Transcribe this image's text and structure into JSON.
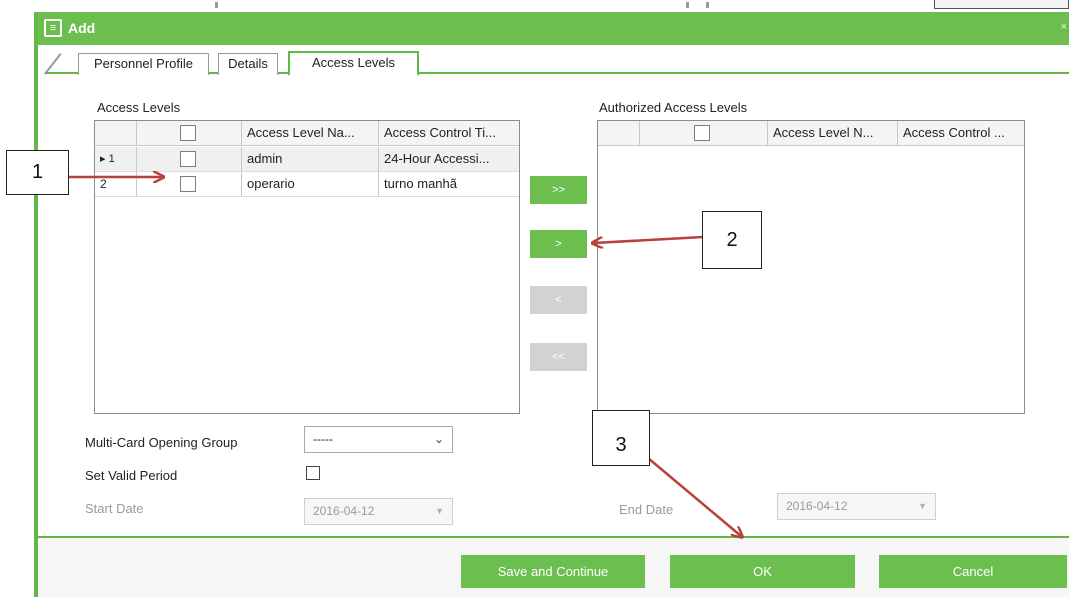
{
  "dialog": {
    "title": "Add",
    "title_icon": "form-icon",
    "close_glyph": "×"
  },
  "tabs": [
    {
      "label": "Personnel Profile"
    },
    {
      "label": "Details"
    },
    {
      "label": "Access  Levels",
      "active": true
    }
  ],
  "access_levels": {
    "label": "Access Levels",
    "columns": [
      "",
      "",
      "Access Level Na...",
      "Access Control Ti..."
    ],
    "rows": [
      {
        "index": "1",
        "marker": "▸",
        "name": "admin",
        "time": "24-Hour Accessi...",
        "selected": true
      },
      {
        "index": "2",
        "marker": "",
        "name": "operario",
        "time": "turno manhã",
        "selected": false
      }
    ]
  },
  "authorized_levels": {
    "label": "Authorized Access Levels",
    "columns": [
      "",
      "",
      "Access Level N...",
      "Access Control ..."
    ],
    "rows": []
  },
  "move_buttons": [
    {
      "label": ">>",
      "enabled": true
    },
    {
      "label": ">",
      "enabled": true
    },
    {
      "label": "<",
      "enabled": false
    },
    {
      "label": "<<",
      "enabled": false
    }
  ],
  "form": {
    "multicard_label": "Multi-Card Opening Group",
    "multicard_value": "-----",
    "valid_period_label": "Set Valid Period",
    "start_label": "Start Date",
    "start_value": "2016-04-12",
    "end_label": "End Date",
    "end_value": "2016-04-12"
  },
  "footer": {
    "save_continue": "Save and Continue",
    "ok": "OK",
    "cancel": "Cancel"
  },
  "callouts": [
    "1",
    "2",
    "3"
  ],
  "colors": {
    "accent_green": "#6cbf4f",
    "annotation_arrow": "#b9413b",
    "disabled_button": "#d2d2d2"
  }
}
